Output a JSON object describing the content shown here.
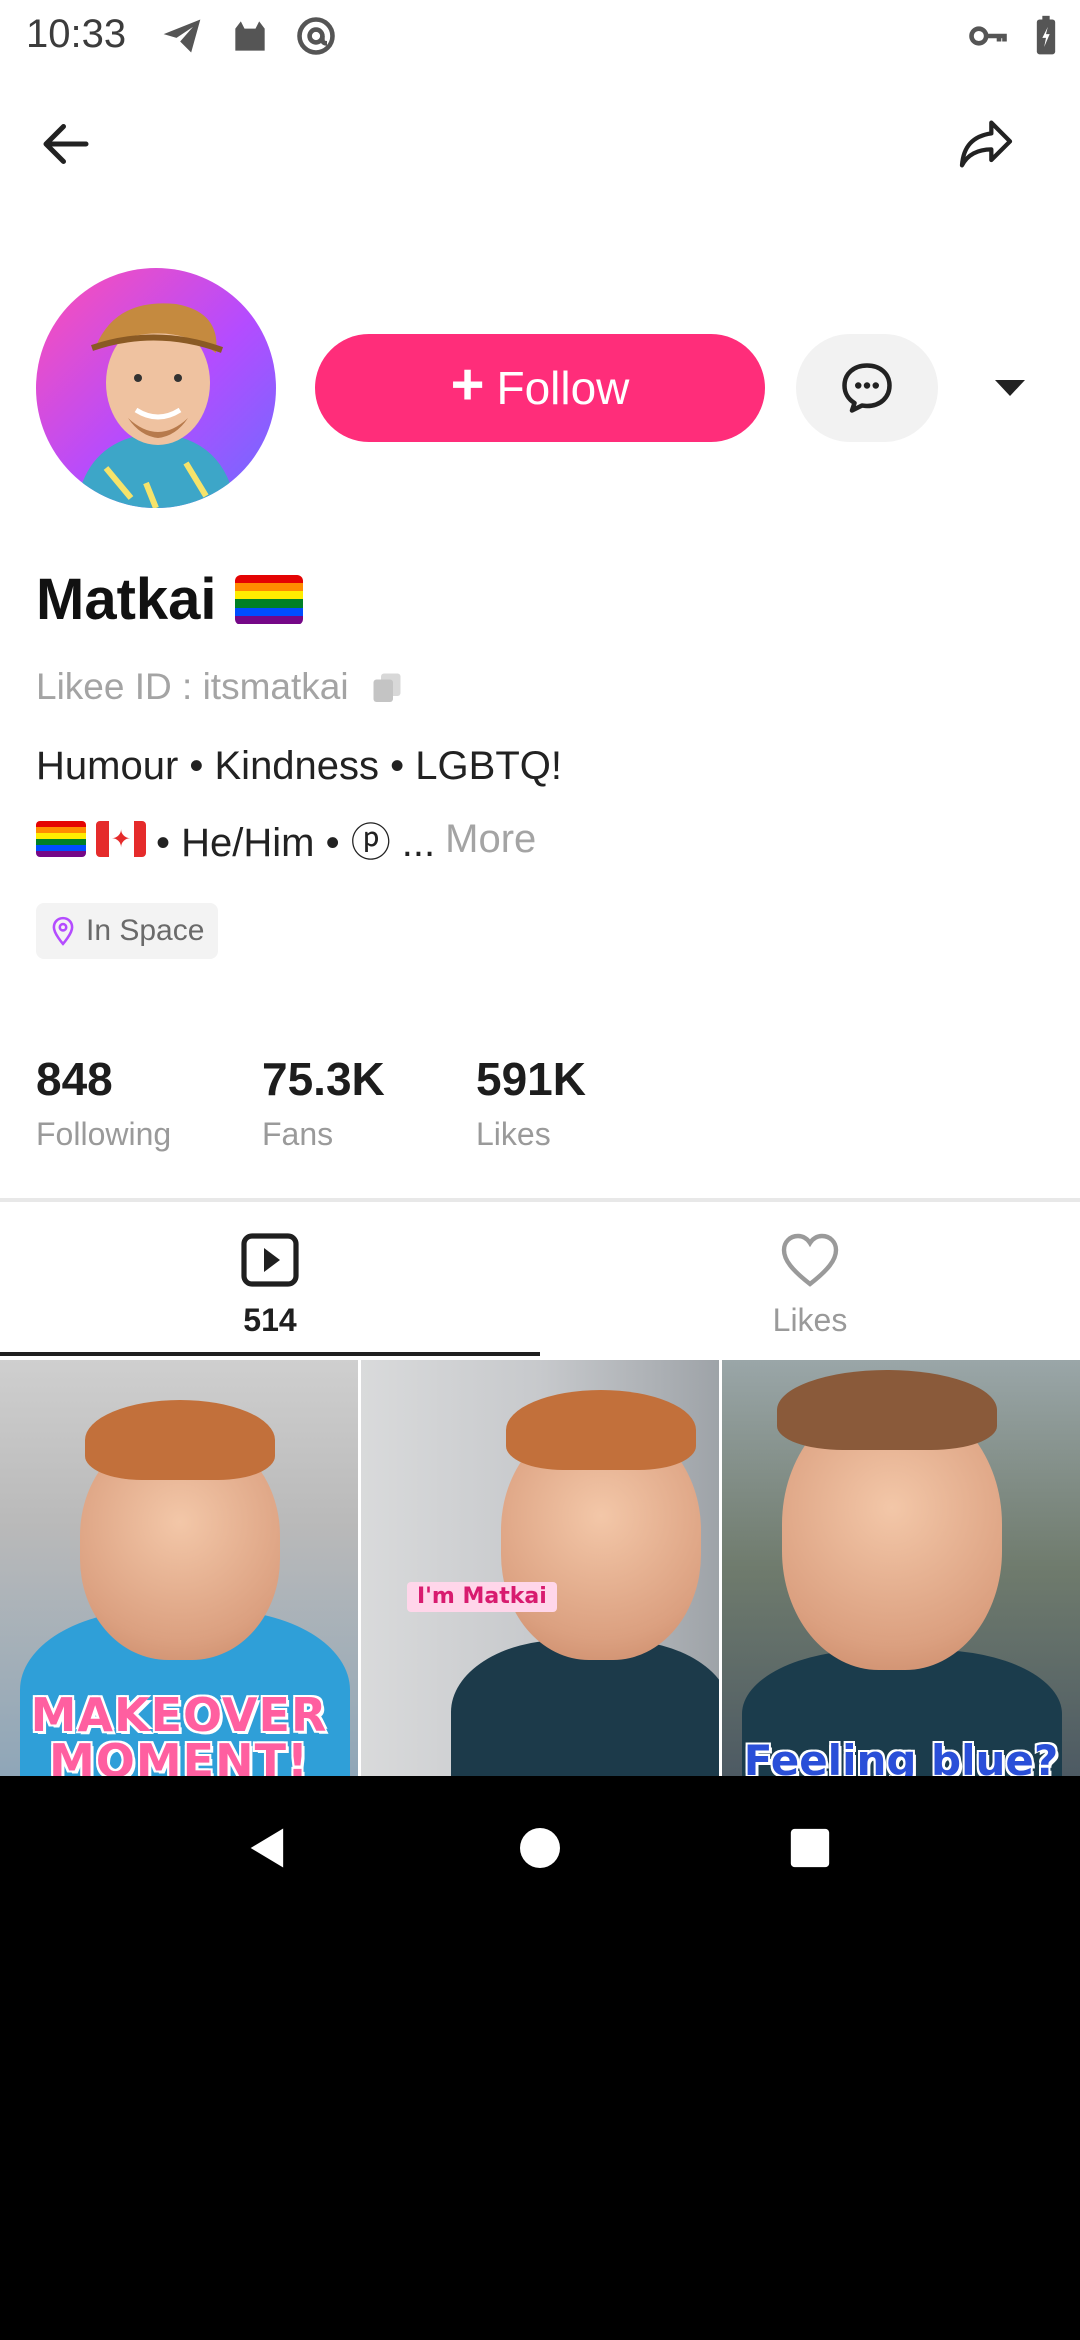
{
  "status_bar": {
    "time": "10:33",
    "icons": [
      "telegram-icon",
      "cat-icon",
      "at-icon",
      "vpn-key-icon",
      "battery-icon"
    ]
  },
  "top_bar": {
    "back_icon": "arrow-left-icon",
    "share_icon": "share-arrow-icon"
  },
  "profile": {
    "name": "Matkai",
    "name_emoji": "rainbow-flag",
    "likee_id_label": "Likee ID : itsmatkai",
    "bio_line1": "Humour • Kindness • LGBTQ!",
    "bio_line2_text": "• He/Him • ⓟ ...",
    "bio_more": "More",
    "location": "In Space",
    "follow_label": "Follow",
    "colors": {
      "follow": "#ff2d7a",
      "accent_location": "#b44cff"
    }
  },
  "stats": [
    {
      "value": "848",
      "label": "Following"
    },
    {
      "value": "75.3K",
      "label": "Fans"
    },
    {
      "value": "591K",
      "label": "Likes"
    }
  ],
  "tabs": [
    {
      "icon": "video-play-icon",
      "label": "514",
      "active": true
    },
    {
      "icon": "heart-icon",
      "label": "Likes",
      "active": false
    }
  ],
  "videos": [
    {
      "caption": "MAKEOVER MOMENT!"
    },
    {
      "caption": "I'm Matkai"
    },
    {
      "caption": "Feeling blue?"
    }
  ]
}
